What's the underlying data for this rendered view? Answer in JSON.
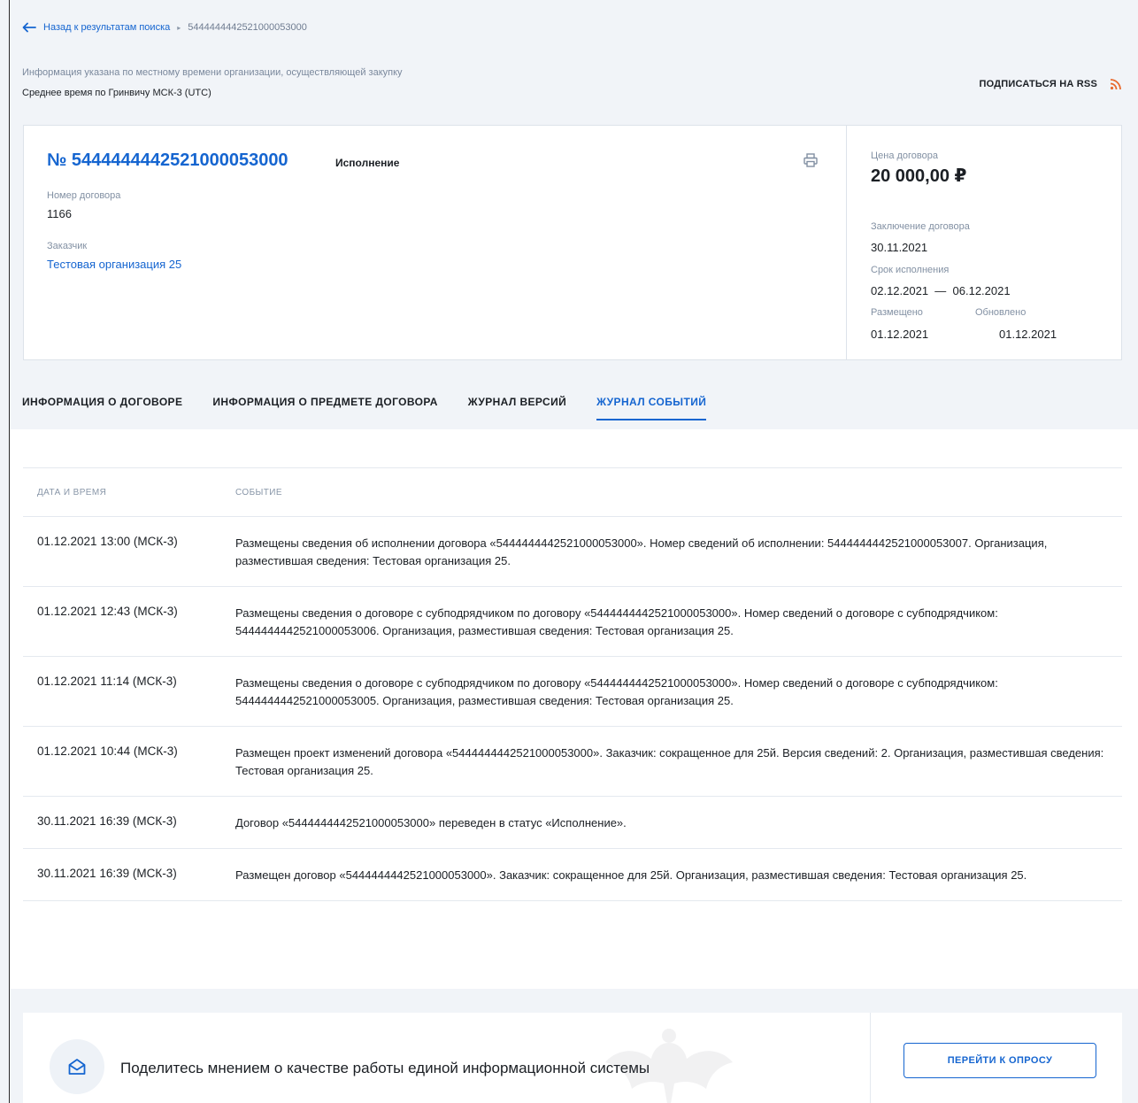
{
  "breadcrumb": {
    "back_label": "Назад к результатам поиска",
    "separator": "▸",
    "current": "5444444442521000053000"
  },
  "timezone": {
    "note": "Информация указана по местному времени организации, осуществляющей закупку",
    "value": "Среднее время по Гринвичу МСК-3 (UTC)"
  },
  "rss": {
    "label": "ПОДПИСАТЬСЯ НА RSS",
    "icon": "rss-icon",
    "color": "#e8692d"
  },
  "contract": {
    "number": "№ 5444444442521000053000",
    "status": "Исполнение",
    "contract_number_label": "Номер договора",
    "contract_number": "1166",
    "customer_label": "Заказчик",
    "customer": "Тестовая организация 25",
    "print_icon": "printer-icon"
  },
  "summary": {
    "price_label": "Цена договора",
    "price": "20 000,00 ₽",
    "conclusion_label": "Заключение договора",
    "conclusion_date": "30.11.2021",
    "term_label": "Срок исполнения",
    "term": "02.12.2021  —  06.12.2021",
    "placed_label": "Размещено",
    "placed": "01.12.2021",
    "updated_label": "Обновлено",
    "updated": "01.12.2021"
  },
  "tabs": [
    {
      "label": "ИНФОРМАЦИЯ О ДОГОВОРЕ",
      "active": false
    },
    {
      "label": "ИНФОРМАЦИЯ О ПРЕДМЕТЕ ДОГОВОРА",
      "active": false
    },
    {
      "label": "ЖУРНАЛ ВЕРСИЙ",
      "active": false
    },
    {
      "label": "ЖУРНАЛ СОБЫТИЙ",
      "active": true
    }
  ],
  "events": {
    "headers": {
      "date": "ДАТА И ВРЕМЯ",
      "event": "СОБЫТИЕ"
    },
    "rows": [
      {
        "date": "01.12.2021 13:00 (МСК-3)",
        "text": "Размещены сведения об исполнении договора «5444444442521000053000». Номер сведений об исполнении: 5444444442521000053007. Организация, разместившая сведения: Тестовая организация 25."
      },
      {
        "date": "01.12.2021 12:43 (МСК-3)",
        "text": "Размещены сведения о договоре с субподрядчиком по договору «5444444442521000053000». Номер сведений о договоре с субподрядчиком: 5444444442521000053006. Организация, разместившая сведения: Тестовая организация 25."
      },
      {
        "date": "01.12.2021 11:14 (МСК-3)",
        "text": "Размещены сведения о договоре с субподрядчиком по договору «5444444442521000053000». Номер сведений о договоре с субподрядчиком: 5444444442521000053005. Организация, разместившая сведения: Тестовая организация 25."
      },
      {
        "date": "01.12.2021 10:44 (МСК-3)",
        "text": "Размещен проект изменений договора «5444444442521000053000». Заказчик: сокращенное для 25й. Версия сведений: 2. Организация, разместившая сведения: Тестовая организация 25."
      },
      {
        "date": "30.11.2021 16:39 (МСК-3)",
        "text": "Договор «5444444442521000053000» переведен в статус «Исполнение»."
      },
      {
        "date": "30.11.2021 16:39 (МСК-3)",
        "text": "Размещен договор «5444444442521000053000». Заказчик: сокращенное для 25й. Организация, разместившая сведения: Тестовая организация 25."
      }
    ]
  },
  "feedback": {
    "icon": "envelope-icon",
    "text": "Поделитесь мнением о качестве работы единой информационной системы",
    "button": "ПЕРЕЙТИ К ОПРОСУ"
  },
  "colors": {
    "accent": "#1565d0",
    "background": "#f1f4f8",
    "rss": "#e8692d"
  }
}
